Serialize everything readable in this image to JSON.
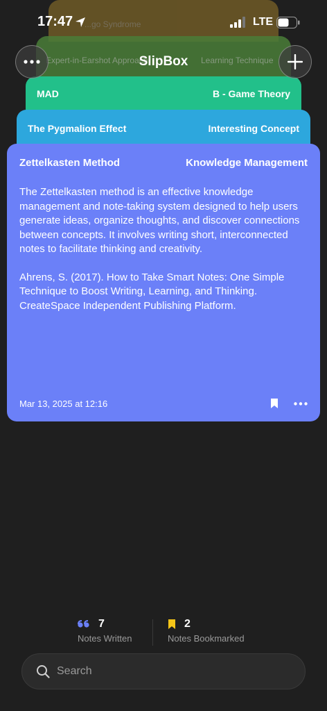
{
  "status_bar": {
    "time": "17:47",
    "network": "LTE"
  },
  "header": {
    "title": "SlipBox"
  },
  "background_cards": [
    {
      "left": "...go Syndrome"
    },
    {
      "left": "Expert-in-Earshot Approach",
      "right": "Learning Technique"
    }
  ],
  "cards": [
    {
      "title": "MAD",
      "category": "B - Game Theory",
      "color": "#22c08a"
    },
    {
      "title": "The Pygmalion Effect",
      "category": "Interesting Concept",
      "color": "#2da7dd"
    }
  ],
  "main_card": {
    "title": "Zettelkasten Method",
    "category": "Knowledge Management",
    "body": "The Zettelkasten method is an effective knowledge management and note-taking system designed to help users generate ideas, organize thoughts, and discover connections between concepts. It involves writing short, interconnected notes to facilitate thinking and creativity.",
    "reference": "Ahrens, S. (2017). How to Take Smart Notes: One Simple Technique to Boost Writing, Learning, and Thinking. CreateSpace Independent Publishing Platform.",
    "date": "Mar 13, 2025 at 12:16",
    "color": "#6b80f8"
  },
  "stats": {
    "written_count": "7",
    "written_label": "Notes Written",
    "bookmarked_count": "2",
    "bookmarked_label": "Notes Bookmarked"
  },
  "search": {
    "placeholder": "Search"
  },
  "icons": [
    "location-arrow-icon",
    "signal-icon",
    "battery-icon",
    "more-icon",
    "plus-icon",
    "bookmark-icon",
    "quote-icon",
    "search-icon"
  ]
}
